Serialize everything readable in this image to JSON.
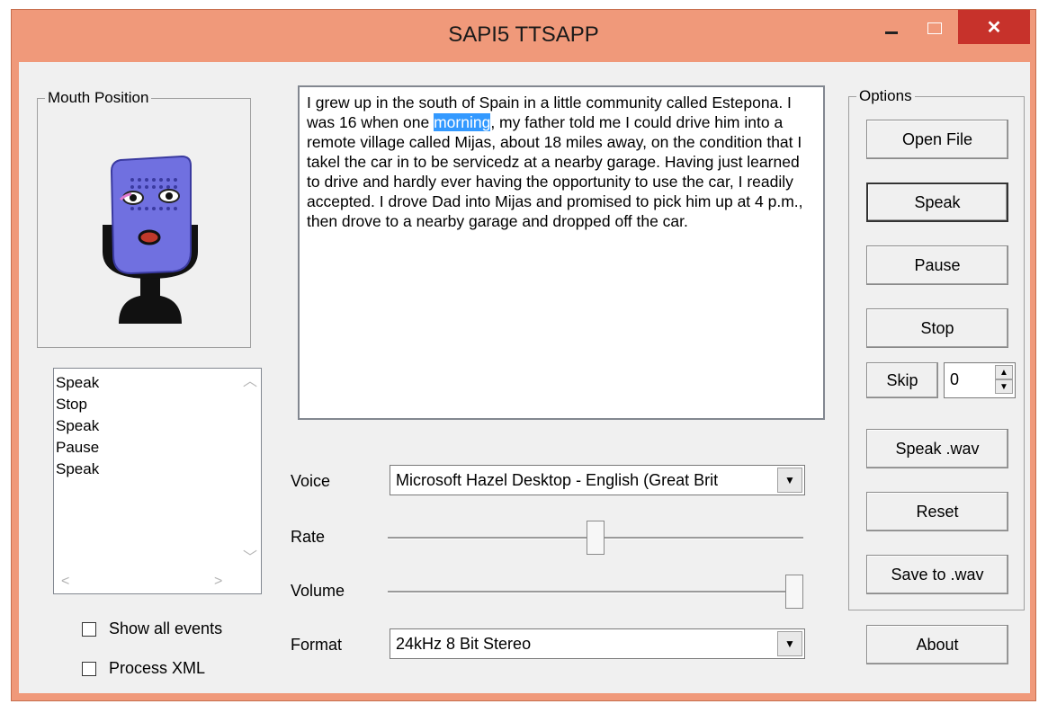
{
  "window": {
    "title": "SAPI5 TTSAPP",
    "close_glyph": "✕"
  },
  "mouth_group": {
    "label": "Mouth Position"
  },
  "event_list": {
    "items": [
      "Speak",
      "Stop",
      "Speak",
      "Pause",
      "Speak"
    ]
  },
  "checkboxes": {
    "show_all_events": "Show all events",
    "process_xml": "Process XML"
  },
  "text": {
    "before": "I grew up in the south of Spain in a little community called Estepona. I was 16 when one ",
    "highlight": "morning",
    "after": ", my father told me I could drive him into a remote village called Mijas, about 18 miles away, on the condition that I takel the car in to be servicedz at a nearby garage. Having just learned to drive and hardly ever having the opportunity to use the car, I readily accepted. I drove Dad into Mijas and promised to pick him up at 4 p.m., then drove to a nearby garage and dropped off the car."
  },
  "voice": {
    "label": "Voice",
    "value": "Microsoft Hazel Desktop - English (Great Brit"
  },
  "rate": {
    "label": "Rate",
    "level": 0.5
  },
  "volume": {
    "label": "Volume",
    "level": 1.0
  },
  "format": {
    "label": "Format",
    "value": "24kHz 8 Bit Stereo"
  },
  "options": {
    "label": "Options",
    "open_file": "Open File",
    "speak": "Speak",
    "pause": "Pause",
    "stop": "Stop",
    "skip": "Skip",
    "skip_value": "0",
    "speak_wav": "Speak .wav",
    "reset": "Reset",
    "save_wav": "Save to .wav"
  },
  "about": "About"
}
